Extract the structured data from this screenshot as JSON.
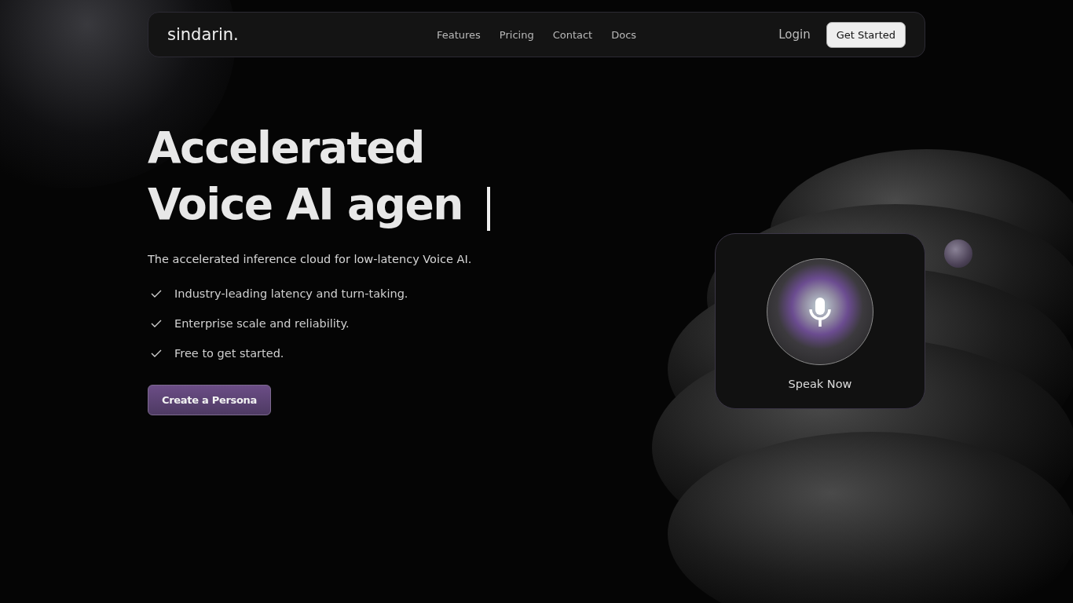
{
  "nav": {
    "logo": "sindarin.",
    "links": [
      "Features",
      "Pricing",
      "Contact",
      "Docs"
    ],
    "login": "Login",
    "cta": "Get Started"
  },
  "hero": {
    "headline": [
      "Accelerated",
      "Voice AI agen"
    ],
    "subtitle": "The accelerated inference cloud for low-latency Voice AI.",
    "features": [
      "Industry-leading latency and turn-taking.",
      "Enterprise scale and reliability.",
      "Free to get started."
    ],
    "button": "Create a Persona"
  },
  "voice_card": {
    "label": "Speak Now"
  }
}
